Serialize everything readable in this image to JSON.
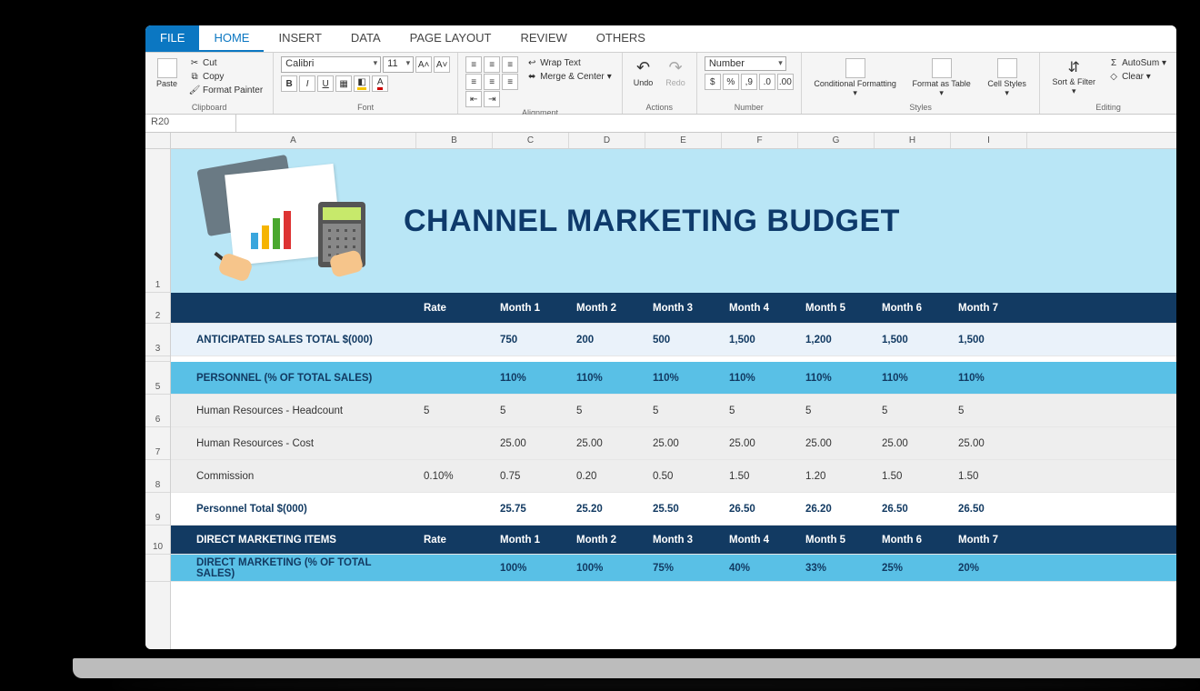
{
  "tabs": {
    "file": "FILE",
    "home": "HOME",
    "insert": "INSERT",
    "data": "DATA",
    "page_layout": "PAGE LAYOUT",
    "review": "REVIEW",
    "others": "OTHERS"
  },
  "ribbon": {
    "clipboard": {
      "cut": "Cut",
      "copy": "Copy",
      "format_painter": "Format Painter",
      "label": "Clipboard"
    },
    "font": {
      "family": "Calibri",
      "size": "11",
      "bold": "B",
      "italic": "I",
      "underline": "U",
      "label": "Font",
      "aplus": "A˄",
      "aminus": "A˅"
    },
    "alignment": {
      "wrap": "Wrap Text",
      "merge": "Merge & Center",
      "label": "Alignment"
    },
    "actions": {
      "undo": "Undo",
      "redo": "Redo",
      "label": "Actions"
    },
    "number": {
      "format": "Number",
      "label": "Number",
      "currency": "$",
      "percent": "%",
      "comma": ",9",
      "inc": ".0",
      "dec": ".00"
    },
    "styles": {
      "cond": "Conditional Formatting ▾",
      "fmt": "Format as Table ▾",
      "cell": "Cell Styles ▾",
      "label": "Styles"
    },
    "editing": {
      "autosum": "AutoSum ▾",
      "clear": "Clear ▾",
      "sort": "Sort & Filter ▾",
      "label": "Editing"
    }
  },
  "cellref": "R20",
  "columns": [
    "A",
    "B",
    "C",
    "D",
    "E",
    "F",
    "G",
    "H",
    "I"
  ],
  "row_nums": [
    "1",
    "2",
    "3",
    "",
    "5",
    "6",
    "7",
    "8",
    "9",
    "10",
    ""
  ],
  "banner_title": "CHANNEL MARKETING BUDGET",
  "header_row": {
    "rate": "Rate",
    "months": [
      "Month 1",
      "Month 2",
      "Month 3",
      "Month 4",
      "Month 5",
      "Month 6",
      "Month 7"
    ]
  },
  "rows": {
    "anticipated": {
      "label": "ANTICIPATED SALES TOTAL $(000)",
      "rate": "",
      "vals": [
        "750",
        "200",
        "500",
        "1,500",
        "1,200",
        "1,500",
        "1,500"
      ]
    },
    "personnel_pct": {
      "label": "PERSONNEL (% OF TOTAL SALES)",
      "rate": "",
      "vals": [
        "110%",
        "110%",
        "110%",
        "110%",
        "110%",
        "110%",
        "110%"
      ]
    },
    "hr_head": {
      "label": "Human Resources - Headcount",
      "rate": "5",
      "vals": [
        "5",
        "5",
        "5",
        "5",
        "5",
        "5",
        "5"
      ]
    },
    "hr_cost": {
      "label": "Human Resources - Cost",
      "rate": "",
      "vals": [
        "25.00",
        "25.00",
        "25.00",
        "25.00",
        "25.00",
        "25.00",
        "25.00"
      ]
    },
    "commission": {
      "label": "Commission",
      "rate": "0.10%",
      "vals": [
        "0.75",
        "0.20",
        "0.50",
        "1.50",
        "1.20",
        "1.50",
        "1.50"
      ]
    },
    "ptotal": {
      "label": "Personnel Total $(000)",
      "rate": "",
      "vals": [
        "25.75",
        "25.20",
        "25.50",
        "26.50",
        "26.20",
        "26.50",
        "26.50"
      ]
    },
    "direct_items": {
      "label": "DIRECT MARKETING ITEMS",
      "rate": "Rate",
      "vals": [
        "Month 1",
        "Month 2",
        "Month 3",
        "Month 4",
        "Month 5",
        "Month 6",
        "Month 7"
      ]
    },
    "direct_pct": {
      "label": "DIRECT MARKETING (% OF TOTAL SALES)",
      "rate": "",
      "vals": [
        "100%",
        "100%",
        "75%",
        "40%",
        "33%",
        "25%",
        "20%"
      ]
    }
  }
}
